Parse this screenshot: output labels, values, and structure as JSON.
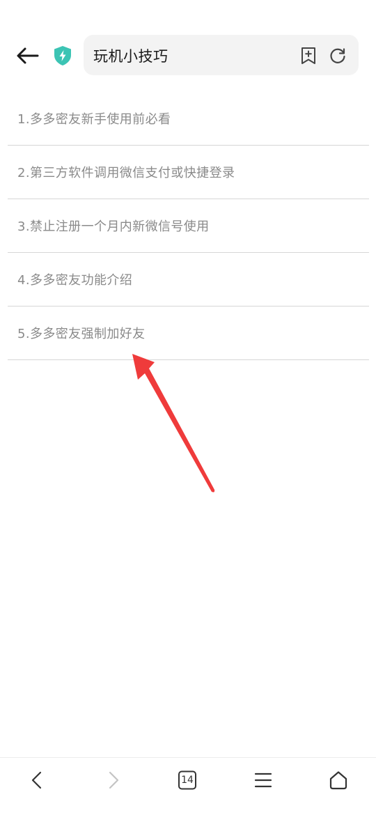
{
  "header": {
    "url_title": "玩机小技巧"
  },
  "articles": [
    {
      "label": "1.多多密友新手使用前必看"
    },
    {
      "label": "2.第三方软件调用微信支付或快捷登录"
    },
    {
      "label": "3.禁止注册一个月内新微信号使用"
    },
    {
      "label": "4.多多密友功能介绍"
    },
    {
      "label": "5.多多密友强制加好友"
    }
  ],
  "bottom_nav": {
    "tab_count": "14"
  },
  "icons": {
    "back": "back-arrow-icon",
    "shield": "security-shield-icon",
    "bookmark": "add-bookmark-icon",
    "refresh": "refresh-icon",
    "nav_back": "chevron-left-icon",
    "nav_forward": "chevron-right-icon",
    "menu": "menu-icon",
    "home": "home-icon"
  },
  "colors": {
    "shield": "#3cc4b4",
    "annotation_arrow": "#ef3b3b",
    "list_text": "#8a8a8a"
  }
}
